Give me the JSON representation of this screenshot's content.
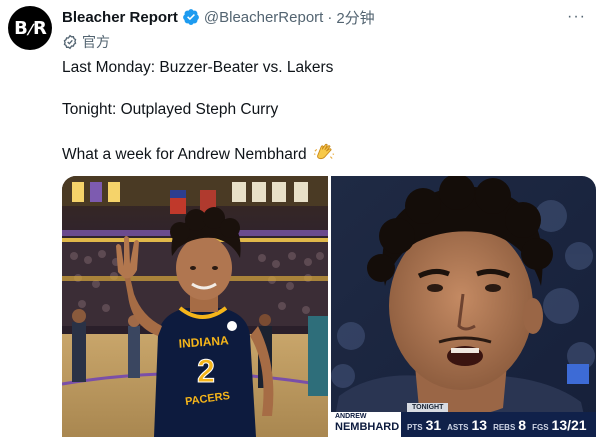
{
  "account": {
    "avatar_text": "B/R",
    "name": "Bleacher Report",
    "handle": "@BleacherReport",
    "separator": "·",
    "time": "2分钟",
    "label": "官方"
  },
  "more_label": "···",
  "tweet": {
    "line1": "Last Monday: Buzzer-Beater vs. Lakers",
    "line2": "Tonight: Outplayed Steph Curry",
    "line3": "What a week for Andrew Nembhard"
  },
  "media": {
    "left_jersey_team": "INDIANA",
    "left_jersey_number": "2",
    "left_jersey_bottom": "PACERS",
    "scorebug": {
      "tag": "TONIGHT",
      "first_name": "ANDREW",
      "last_name": "NEMBHARD",
      "stats": [
        {
          "label": "PTS",
          "value": "31"
        },
        {
          "label": "ASTS",
          "value": "13"
        },
        {
          "label": "REBS",
          "value": "8"
        },
        {
          "label": "FGS",
          "value": "13/21"
        }
      ]
    }
  },
  "colors": {
    "text": "#0f1419",
    "muted": "#536471",
    "verified": "#1d9bf0",
    "pacers_navy": "#0d1b3e",
    "pacers_gold": "#f5b51a"
  }
}
